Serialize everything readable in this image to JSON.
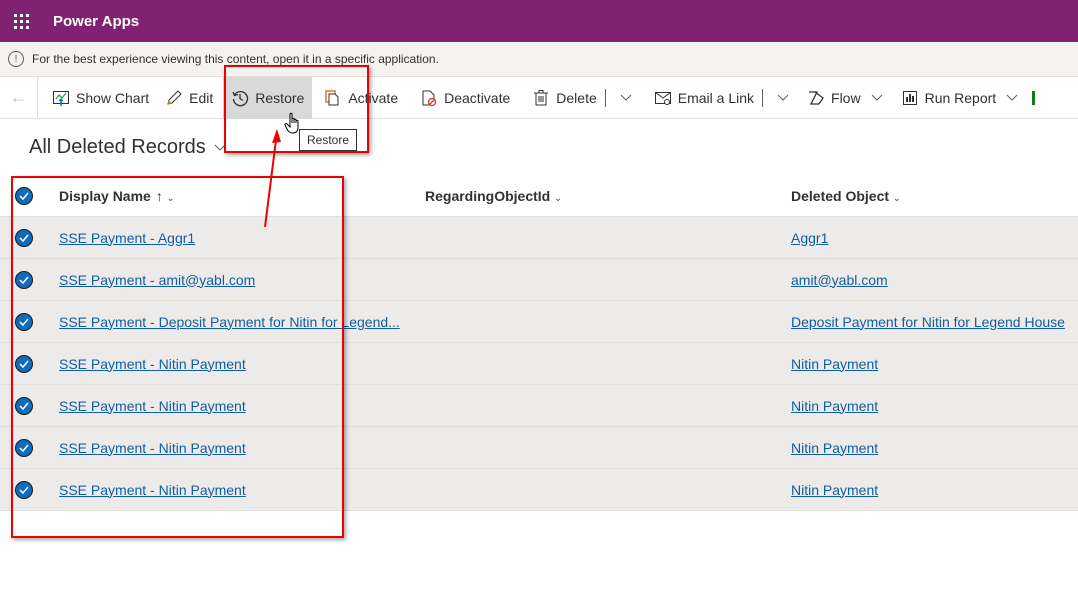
{
  "header": {
    "app_title": "Power Apps",
    "waffle_icon": "waffle-icon"
  },
  "notification": {
    "icon": "info-icon",
    "text": "For the best experience viewing this content, open it in a specific application."
  },
  "commandbar": {
    "back_icon": "back-arrow-icon",
    "items": [
      {
        "label": "Show Chart",
        "icon": "chart-icon"
      },
      {
        "label": "Edit",
        "icon": "pencil-icon"
      },
      {
        "label": "Restore",
        "icon": "history-icon",
        "state": "hover"
      },
      {
        "label": "Activate",
        "icon": "activate-icon"
      },
      {
        "label": "Deactivate",
        "icon": "deactivate-icon"
      },
      {
        "label": "Delete",
        "icon": "trash-icon"
      },
      {
        "label": "Email a Link",
        "icon": "email-link-icon"
      },
      {
        "label": "Flow",
        "icon": "flow-icon"
      },
      {
        "label": "Run Report",
        "icon": "report-icon"
      }
    ]
  },
  "tooltip": {
    "text": "Restore"
  },
  "view": {
    "title": "All Deleted Records"
  },
  "grid": {
    "columns": [
      {
        "label": "Display Name",
        "sort": "ascending"
      },
      {
        "label": "RegardingObjectId"
      },
      {
        "label": "Deleted Object"
      }
    ],
    "rows": [
      {
        "selected": true,
        "display_name": "SSE Payment - Aggr1",
        "regarding": "",
        "deleted_object": "Aggr1"
      },
      {
        "selected": true,
        "display_name": "SSE Payment - amit@yabl.com",
        "regarding": "",
        "deleted_object": "amit@yabl.com"
      },
      {
        "selected": true,
        "display_name": "SSE Payment - Deposit Payment for Nitin for Legend...",
        "regarding": "",
        "deleted_object": "Deposit Payment for Nitin for Legend House"
      },
      {
        "selected": true,
        "display_name": "SSE Payment - Nitin Payment",
        "regarding": "",
        "deleted_object": "Nitin Payment"
      },
      {
        "selected": true,
        "display_name": "SSE Payment - Nitin Payment",
        "regarding": "",
        "deleted_object": "Nitin Payment"
      },
      {
        "selected": true,
        "display_name": "SSE Payment - Nitin Payment",
        "regarding": "",
        "deleted_object": "Nitin Payment"
      },
      {
        "selected": true,
        "display_name": "SSE Payment - Nitin Payment",
        "regarding": "",
        "deleted_object": "Nitin Payment"
      }
    ]
  },
  "colors": {
    "header": "#812172",
    "accent": "#0f6cbd",
    "link": "#115ea3",
    "annotation": "#ee0000"
  }
}
